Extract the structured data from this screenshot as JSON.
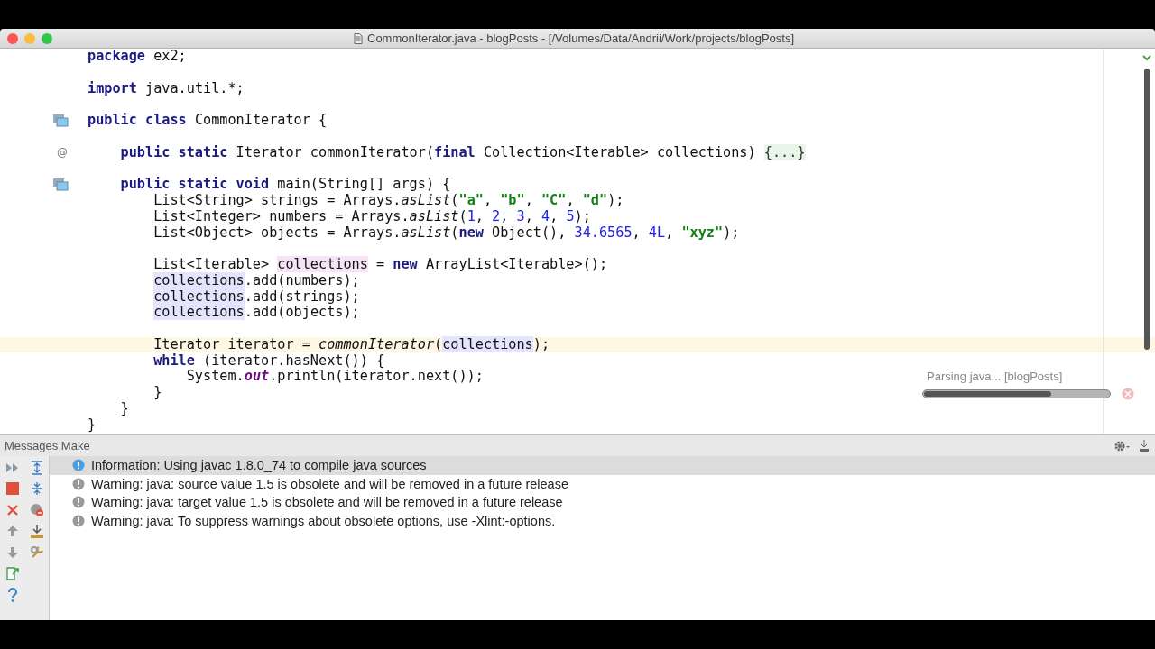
{
  "window": {
    "title": "CommonIterator.java - blogPosts - [/Volumes/Data/Andrii/Work/projects/blogPosts]"
  },
  "editor": {
    "lines": [
      {
        "current": false,
        "tokens": [
          {
            "kind": "keyword",
            "text": "package"
          },
          {
            "kind": "plain",
            "text": " ex2;"
          }
        ]
      },
      {
        "current": false
      },
      {
        "current": false,
        "tokens": [
          {
            "kind": "keyword",
            "text": "import"
          },
          {
            "kind": "plain",
            "text": " java.util.*;"
          }
        ]
      },
      {
        "current": false
      },
      {
        "current": false,
        "gutter": {
          "kind": "icon"
        },
        "tokens": [
          {
            "kind": "keyword",
            "text": "public class"
          },
          {
            "kind": "plain",
            "text": " CommonIterator {"
          }
        ],
        "children": [
          {
            "current": false
          },
          {
            "current": false,
            "gutter": {
              "kind": "text",
              "text": "@"
            },
            "tokens": [
              {
                "kind": "keyword",
                "text": "public static"
              },
              {
                "kind": "plain",
                "text": " Iterator commonIterator("
              },
              {
                "kind": "keyword",
                "text": "final"
              },
              {
                "kind": "plain",
                "text": " Collection<Iterable> collections) "
              },
              {
                "kind": "folded",
                "text": "{...}"
              }
            ]
          },
          {
            "current": false
          },
          {
            "current": false,
            "gutter": {
              "kind": "icon"
            },
            "tokens": [
              {
                "kind": "keyword",
                "text": "public static void"
              },
              {
                "kind": "plain",
                "text": " main(String[] args) {"
              }
            ],
            "children": [
              {
                "current": false,
                "tokens": [
                  {
                    "kind": "plain",
                    "text": "List<String> strings = Arrays."
                  },
                  {
                    "kind": "static-call",
                    "text": "asList"
                  },
                  {
                    "kind": "plain",
                    "text": "("
                  },
                  {
                    "kind": "string",
                    "text": "\"a\""
                  },
                  {
                    "kind": "plain",
                    "text": ", "
                  },
                  {
                    "kind": "string",
                    "text": "\"b\""
                  },
                  {
                    "kind": "plain",
                    "text": ", "
                  },
                  {
                    "kind": "string",
                    "text": "\"C\""
                  },
                  {
                    "kind": "plain",
                    "text": ", "
                  },
                  {
                    "kind": "string",
                    "text": "\"d\""
                  },
                  {
                    "kind": "plain",
                    "text": ");"
                  }
                ]
              },
              {
                "current": false,
                "tokens": [
                  {
                    "kind": "plain",
                    "text": "List<Integer> numbers = Arrays."
                  },
                  {
                    "kind": "static-call",
                    "text": "asList"
                  },
                  {
                    "kind": "plain",
                    "text": "("
                  },
                  {
                    "kind": "number",
                    "text": "1"
                  },
                  {
                    "kind": "plain",
                    "text": ", "
                  },
                  {
                    "kind": "number",
                    "text": "2"
                  },
                  {
                    "kind": "plain",
                    "text": ", "
                  },
                  {
                    "kind": "number",
                    "text": "3"
                  },
                  {
                    "kind": "plain",
                    "text": ", "
                  },
                  {
                    "kind": "number",
                    "text": "4"
                  },
                  {
                    "kind": "plain",
                    "text": ", "
                  },
                  {
                    "kind": "number",
                    "text": "5"
                  },
                  {
                    "kind": "plain",
                    "text": ");"
                  }
                ]
              },
              {
                "current": false,
                "tokens": [
                  {
                    "kind": "plain",
                    "text": "List<Object> objects = Arrays."
                  },
                  {
                    "kind": "static-call",
                    "text": "asList"
                  },
                  {
                    "kind": "plain",
                    "text": "("
                  },
                  {
                    "kind": "keyword",
                    "text": "new"
                  },
                  {
                    "kind": "plain",
                    "text": " Object(), "
                  },
                  {
                    "kind": "number",
                    "text": "34.6565"
                  },
                  {
                    "kind": "plain",
                    "text": ", "
                  },
                  {
                    "kind": "number",
                    "text": "4L"
                  },
                  {
                    "kind": "plain",
                    "text": ", "
                  },
                  {
                    "kind": "string",
                    "text": "\"xyz\""
                  },
                  {
                    "kind": "plain",
                    "text": ");"
                  }
                ]
              },
              {
                "current": false
              },
              {
                "current": false,
                "tokens": [
                  {
                    "kind": "plain",
                    "text": "List<Iterable> "
                  },
                  {
                    "kind": "usage-write",
                    "text": "collections"
                  },
                  {
                    "kind": "plain",
                    "text": " = "
                  },
                  {
                    "kind": "keyword",
                    "text": "new"
                  },
                  {
                    "kind": "plain",
                    "text": " ArrayList<Iterable>();"
                  }
                ]
              },
              {
                "current": false,
                "tokens": [
                  {
                    "kind": "usage-read",
                    "text": "collections"
                  },
                  {
                    "kind": "plain",
                    "text": ".add(numbers);"
                  }
                ]
              },
              {
                "current": false,
                "tokens": [
                  {
                    "kind": "usage-read",
                    "text": "collections"
                  },
                  {
                    "kind": "plain",
                    "text": ".add(strings);"
                  }
                ]
              },
              {
                "current": false,
                "tokens": [
                  {
                    "kind": "usage-read",
                    "text": "collections"
                  },
                  {
                    "kind": "plain",
                    "text": ".add(objects);"
                  }
                ]
              },
              {
                "current": false
              },
              {
                "current": true,
                "tokens": [
                  {
                    "kind": "plain",
                    "text": "Iterator iterator = "
                  },
                  {
                    "kind": "static-call",
                    "text": "commonIterator"
                  },
                  {
                    "kind": "plain",
                    "text": "("
                  },
                  {
                    "kind": "usage-read",
                    "text": "collections"
                  },
                  {
                    "kind": "plain",
                    "text": ");"
                  }
                ]
              },
              {
                "current": false,
                "tokens": [
                  {
                    "kind": "keyword",
                    "text": "while"
                  },
                  {
                    "kind": "plain",
                    "text": " (iterator.hasNext()) {"
                  }
                ],
                "children": [
                  {
                    "current": false,
                    "tokens": [
                      {
                        "kind": "plain",
                        "text": "System."
                      },
                      {
                        "kind": "static-field",
                        "text": "out"
                      },
                      {
                        "kind": "plain",
                        "text": ".println(iterator.next());"
                      }
                    ]
                  }
                ]
              },
              {
                "current": false,
                "tokens": [
                  {
                    "kind": "plain",
                    "text": "}"
                  }
                ]
              }
            ]
          },
          {
            "current": false,
            "tokens": [
              {
                "kind": "plain",
                "text": "}"
              }
            ]
          }
        ]
      },
      {
        "current": false,
        "tokens": [
          {
            "kind": "plain",
            "text": "}"
          }
        ]
      }
    ]
  },
  "progress": {
    "label": "Parsing java... [blogPosts]",
    "level": 0.69
  },
  "messages": {
    "title": "Messages Make",
    "items": [
      {
        "kind": "info",
        "selected": true,
        "text": "Information: Using javac 1.8.0_74 to compile java sources"
      },
      {
        "kind": "warning",
        "selected": false,
        "text": "Warning: java: source value 1.5 is obsolete and will be removed in a future release"
      },
      {
        "kind": "warning",
        "selected": false,
        "text": "Warning: java: target value 1.5 is obsolete and will be removed in a future release"
      },
      {
        "kind": "warning",
        "selected": false,
        "text": "Warning: java: To suppress warnings about obsolete options, use -Xlint:-options."
      }
    ]
  }
}
